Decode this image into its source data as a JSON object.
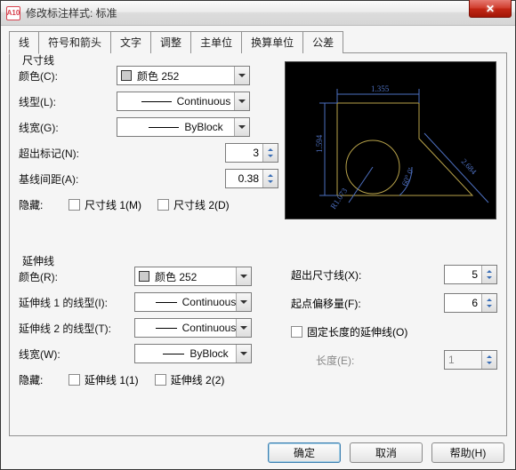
{
  "window": {
    "app_icon_text": "A10",
    "title": "修改标注样式: 标准"
  },
  "tabs": [
    "线",
    "符号和箭头",
    "文字",
    "调整",
    "主单位",
    "换算单位",
    "公差"
  ],
  "group_dimline": {
    "legend": "尺寸线",
    "color_label": "颜色(C):",
    "color_value": "颜色 252",
    "linetype_label": "线型(L):",
    "linetype_value": "Continuous",
    "lineweight_label": "线宽(G):",
    "lineweight_value": "ByBlock",
    "extend_label": "超出标记(N):",
    "extend_value": "3",
    "baseline_label": "基线间距(A):",
    "baseline_value": "0.38",
    "hide_label": "隐藏:",
    "hide1": "尺寸线 1(M)",
    "hide2": "尺寸线 2(D)"
  },
  "group_extline": {
    "legend": "延伸线",
    "color_label": "颜色(R):",
    "color_value": "颜色 252",
    "ext1_label": "延伸线 1 的线型(I):",
    "ext1_value": "Continuous",
    "ext2_label": "延伸线 2 的线型(T):",
    "ext2_value": "Continuous",
    "lineweight_label": "线宽(W):",
    "lineweight_value": "ByBlock",
    "hide_label": "隐藏:",
    "hide1": "延伸线 1(1)",
    "hide2": "延伸线 2(2)",
    "beyond_label": "超出尺寸线(X):",
    "beyond_value": "5",
    "offset_label": "起点偏移量(F):",
    "offset_value": "6",
    "fixed_label": "固定长度的延伸线(O)",
    "length_label": "长度(E):",
    "length_value": "1"
  },
  "preview": {
    "dim_top": "1.355",
    "dim_left": "1.594",
    "dim_diag": "2.684",
    "dim_radius": "R1.073",
    "dim_angle": "60° 0'"
  },
  "buttons": {
    "ok": "确定",
    "cancel": "取消",
    "help": "帮助(H)"
  }
}
